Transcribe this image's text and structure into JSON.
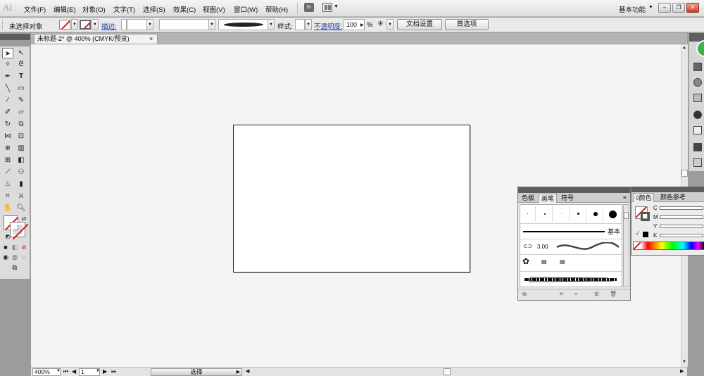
{
  "app": {
    "logo": "Ai"
  },
  "menu": {
    "items": [
      "文件(F)",
      "编辑(E)",
      "对象(O)",
      "文字(T)",
      "选择(S)",
      "效果(C)",
      "视图(V)",
      "窗口(W)",
      "帮助(H)"
    ],
    "bridge_label": "Br",
    "workspace": "基本功能"
  },
  "control": {
    "selection": "未选择对象",
    "stroke_label": "描边:",
    "style_label": "样式:",
    "opacity_label": "不透明度:",
    "opacity_value": "100",
    "opacity_unit": "%",
    "doc_setup": "文档设置",
    "preferences": "首选项"
  },
  "document": {
    "tab_title": "未标题-2* @ 400% (CMYK/预览)",
    "close": "×"
  },
  "brush_panel": {
    "tabs": [
      "色板",
      "画笔",
      "符号"
    ],
    "active_tab": "画笔",
    "basic_label": "基本",
    "stroke_weight": "3.00"
  },
  "color_panel": {
    "tabs": [
      "颜色",
      "颜色参考"
    ],
    "active_tab": "颜色",
    "channels": [
      "C",
      "M",
      "Y",
      "K"
    ]
  },
  "status": {
    "zoom": "400%",
    "page": "1",
    "tool": "选择"
  }
}
